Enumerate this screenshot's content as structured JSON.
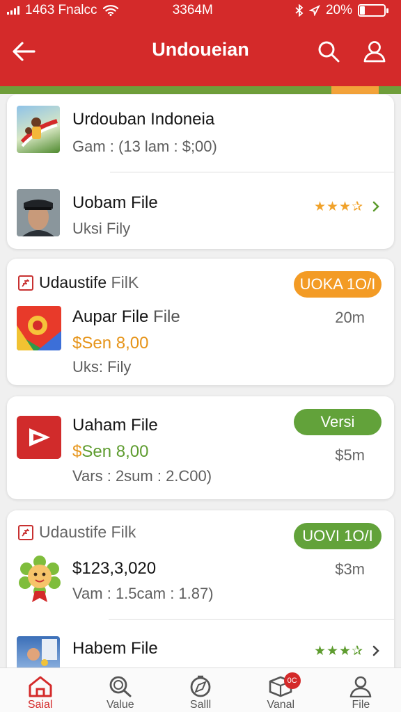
{
  "status": {
    "carrier": "1463 Fnalcc",
    "time": "3364M",
    "battery": "20%",
    "battery_level": 0.2
  },
  "header": {
    "title": "Undoueian"
  },
  "cards": [
    {
      "items": [
        {
          "name": "Urdouban Indoneia",
          "sub": "Gam : (13 lam : $;00)"
        },
        {
          "name": "Uobam File",
          "sub": "Uksi Fily",
          "rating_stars": "★★★✰"
        }
      ]
    },
    {
      "section": {
        "title_main": "Udaustife",
        "title_muted": " FilK",
        "pill": "UOKA 1O/I"
      },
      "item": {
        "name_main": "Aupar File",
        "name_muted": " File",
        "price": "$Sen 8,00",
        "sub": "Uks: Fily",
        "meta": "20m"
      }
    },
    {
      "item": {
        "name": "Uaham File",
        "price": "$Sen 8,00",
        "sub": "Vars : 2sum : 2.C00)",
        "pill": "Versi",
        "meta": "$5m"
      }
    },
    {
      "section": {
        "title_main": "Udaustife",
        "title_muted": " Filk",
        "pill": "UOVI 1O/I"
      },
      "items": [
        {
          "name": "$123,3,020",
          "sub": "Vam : 1.5cam : 1.87)",
          "meta": "$3m"
        },
        {
          "name": "Habem File",
          "rating_stars": "★★★✰"
        }
      ]
    }
  ],
  "tabs": [
    {
      "label": "Saial",
      "icon": "home-icon",
      "active": true
    },
    {
      "label": "Value",
      "icon": "search-icon"
    },
    {
      "label": "Salll",
      "icon": "compass-icon"
    },
    {
      "label": "Vanal",
      "icon": "box-icon",
      "badge": "0C"
    },
    {
      "label": "File",
      "icon": "user-icon"
    }
  ],
  "colors": {
    "brand_red": "#d42a2a",
    "accent_green": "#6f9e3a",
    "accent_orange": "#f3a23a"
  }
}
